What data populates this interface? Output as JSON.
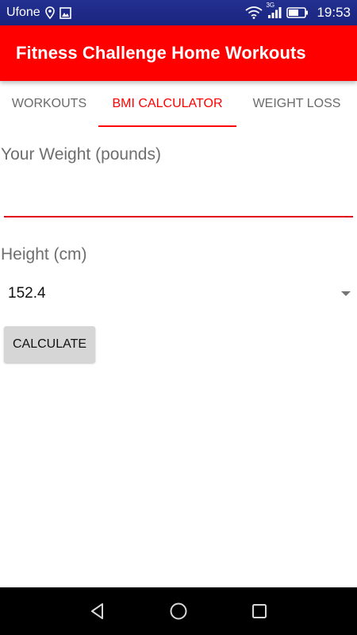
{
  "status_bar": {
    "carrier": "Ufone",
    "network_type": "3G",
    "time": "19:53",
    "icons": [
      "location-icon",
      "image-icon",
      "wifi-icon",
      "signal-icon",
      "battery-icon"
    ]
  },
  "app_bar": {
    "title": "Fitness Challenge Home Workouts",
    "color": "#ff0000"
  },
  "tabs": [
    {
      "label": "WORKOUTS",
      "active": false
    },
    {
      "label": "BMI CALCULATOR",
      "active": true
    },
    {
      "label": "WEIGHT LOSS",
      "active": false
    }
  ],
  "form": {
    "weight_label": "Your Weight (pounds)",
    "weight_value": "",
    "height_label": "Height (cm)",
    "height_selected": "152.4",
    "calculate_label": "CALCULATE"
  },
  "nav_bar": {
    "icons": [
      "back-icon",
      "home-icon",
      "recents-icon"
    ]
  }
}
